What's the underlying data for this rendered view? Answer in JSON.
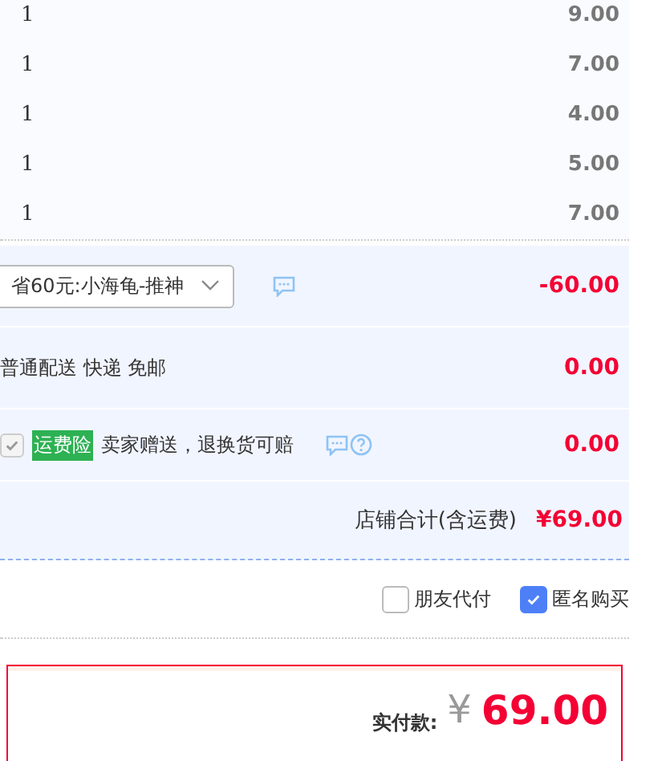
{
  "items": [
    {
      "quantity": "1",
      "price": "9.00"
    },
    {
      "quantity": "1",
      "price": "7.00"
    },
    {
      "quantity": "1",
      "price": "4.00"
    },
    {
      "quantity": "1",
      "price": "5.00"
    },
    {
      "quantity": "1",
      "price": "7.00"
    }
  ],
  "coupon": {
    "value": "省60元:小海龟-推神",
    "amount": "-60.00"
  },
  "delivery": {
    "text": "普通配送 快递 免邮",
    "amount": "0.00"
  },
  "insurance": {
    "checked": true,
    "disabled": true,
    "badge": "运费险",
    "text": "卖家赠送，退换货可赔",
    "amount": "0.00"
  },
  "store_total": {
    "label": "店铺合计(含运费)",
    "amount": "¥69.00"
  },
  "options": [
    {
      "label": "朋友代付",
      "checked": false
    },
    {
      "label": "匿名购买",
      "checked": true
    }
  ],
  "payment": {
    "label": "实付款:",
    "currency": "¥",
    "amount": "69.00"
  }
}
